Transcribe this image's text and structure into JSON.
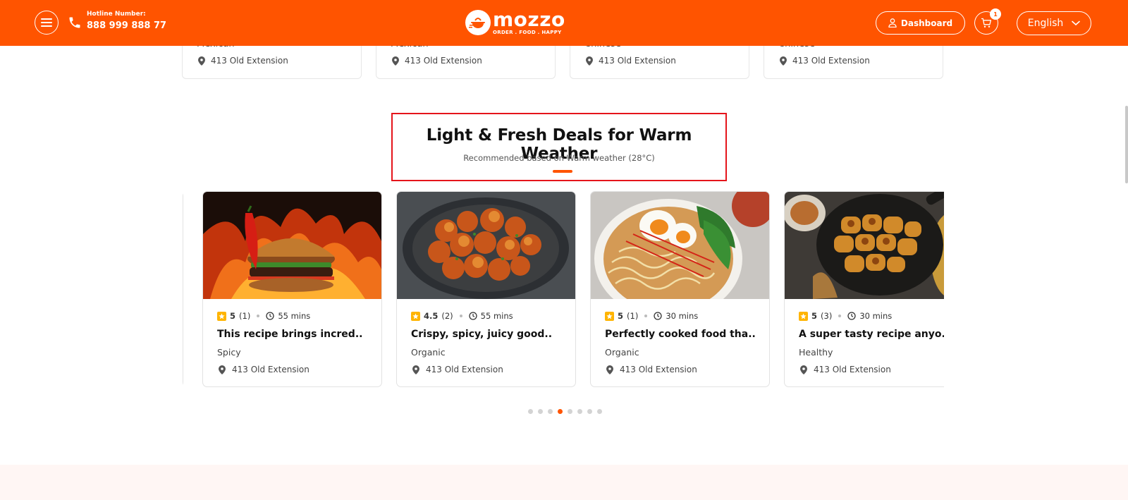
{
  "header": {
    "hotline_label": "Hotline Number:",
    "hotline_number": "888 999 888 77",
    "logo_name": "mozzo",
    "logo_tagline": "ORDER . FOOD . HAPPY",
    "dashboard_label": "Dashboard",
    "cart_count": "1",
    "language": "English",
    "brand_color": "#ff5400"
  },
  "top_cards": [
    {
      "category": "Mexican",
      "location": "413 Old Extension"
    },
    {
      "category": "Mexican",
      "location": "413 Old Extension"
    },
    {
      "category": "Chinese",
      "location": "413 Old Extension"
    },
    {
      "category": "Chinese",
      "location": "413 Old Extension"
    }
  ],
  "section": {
    "title": "Light & Fresh Deals for Warm Weather",
    "subtitle": "Recommended based on Warm weather (28°C)"
  },
  "cards": [
    {
      "rating": "5",
      "reviews": "(1)",
      "time": "55 mins",
      "title": "This recipe brings incred..",
      "category": "Spicy",
      "location": "413 Old Extension",
      "image": "flaming-burger"
    },
    {
      "rating": "4.5",
      "reviews": "(2)",
      "time": "55 mins",
      "title": "Crispy, spicy, juicy good..",
      "category": "Organic",
      "location": "413 Old Extension",
      "image": "fried-chicken"
    },
    {
      "rating": "5",
      "reviews": "(1)",
      "time": "30 mins",
      "title": "Perfectly cooked food tha..",
      "category": "Organic",
      "location": "413 Old Extension",
      "image": "ramen-bowl"
    },
    {
      "rating": "5",
      "reviews": "(3)",
      "time": "30 mins",
      "title": "A super tasty recipe anyo..",
      "category": "Healthy",
      "location": "413 Old Extension",
      "image": "skillet-rolls"
    }
  ],
  "pagination": {
    "total": 8,
    "active": 4
  }
}
